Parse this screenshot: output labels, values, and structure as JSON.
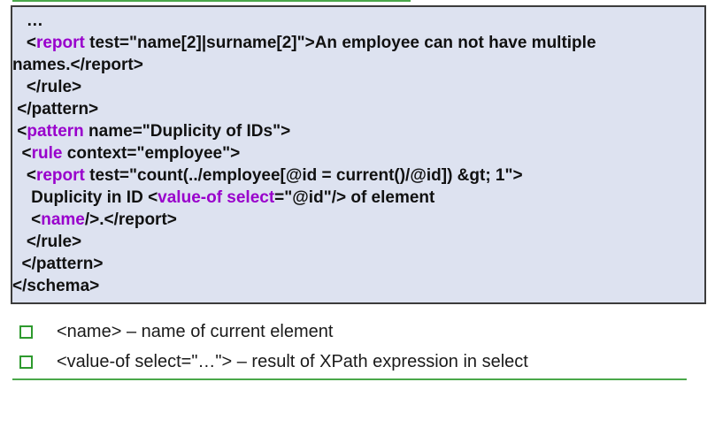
{
  "code": {
    "lines": [
      [
        {
          "t": "   …",
          "k": false
        }
      ],
      [
        {
          "t": "   <",
          "k": false
        },
        {
          "t": "report",
          "k": true
        },
        {
          "t": " test=\"name[2]|surname[2]\">An employee can not have multiple",
          "k": false
        }
      ],
      [
        {
          "t": "names.</report>",
          "k": false
        }
      ],
      [
        {
          "t": "   </rule>",
          "k": false
        }
      ],
      [
        {
          "t": " </pattern>",
          "k": false
        }
      ],
      [
        {
          "t": " <",
          "k": false
        },
        {
          "t": "pattern",
          "k": true
        },
        {
          "t": " name=\"Duplicity of IDs\">",
          "k": false
        }
      ],
      [
        {
          "t": "  <",
          "k": false
        },
        {
          "t": "rule",
          "k": true
        },
        {
          "t": " context=\"employee\">",
          "k": false
        }
      ],
      [
        {
          "t": "   <",
          "k": false
        },
        {
          "t": "report",
          "k": true
        },
        {
          "t": " test=\"count(../employee[@id = current()/@id]) &gt; 1\">",
          "k": false
        }
      ],
      [
        {
          "t": "    Duplicity in ID <",
          "k": false
        },
        {
          "t": "value-of select",
          "k": true
        },
        {
          "t": "=\"@id\"/> of element",
          "k": false
        }
      ],
      [
        {
          "t": "    <",
          "k": false
        },
        {
          "t": "name",
          "k": true
        },
        {
          "t": "/>.</report>",
          "k": false
        }
      ],
      [
        {
          "t": "   </rule>",
          "k": false
        }
      ],
      [
        {
          "t": "  </pattern>",
          "k": false
        }
      ],
      [
        {
          "t": "</schema>",
          "k": false
        }
      ]
    ]
  },
  "bullets": [
    "<name> – name of current element",
    "<value-of select=\"…\"> – result of XPath expression in select"
  ],
  "colors": {
    "keyword": "#9900cc",
    "box_background": "#dde2f0",
    "rule_green": "#4aa84a"
  }
}
